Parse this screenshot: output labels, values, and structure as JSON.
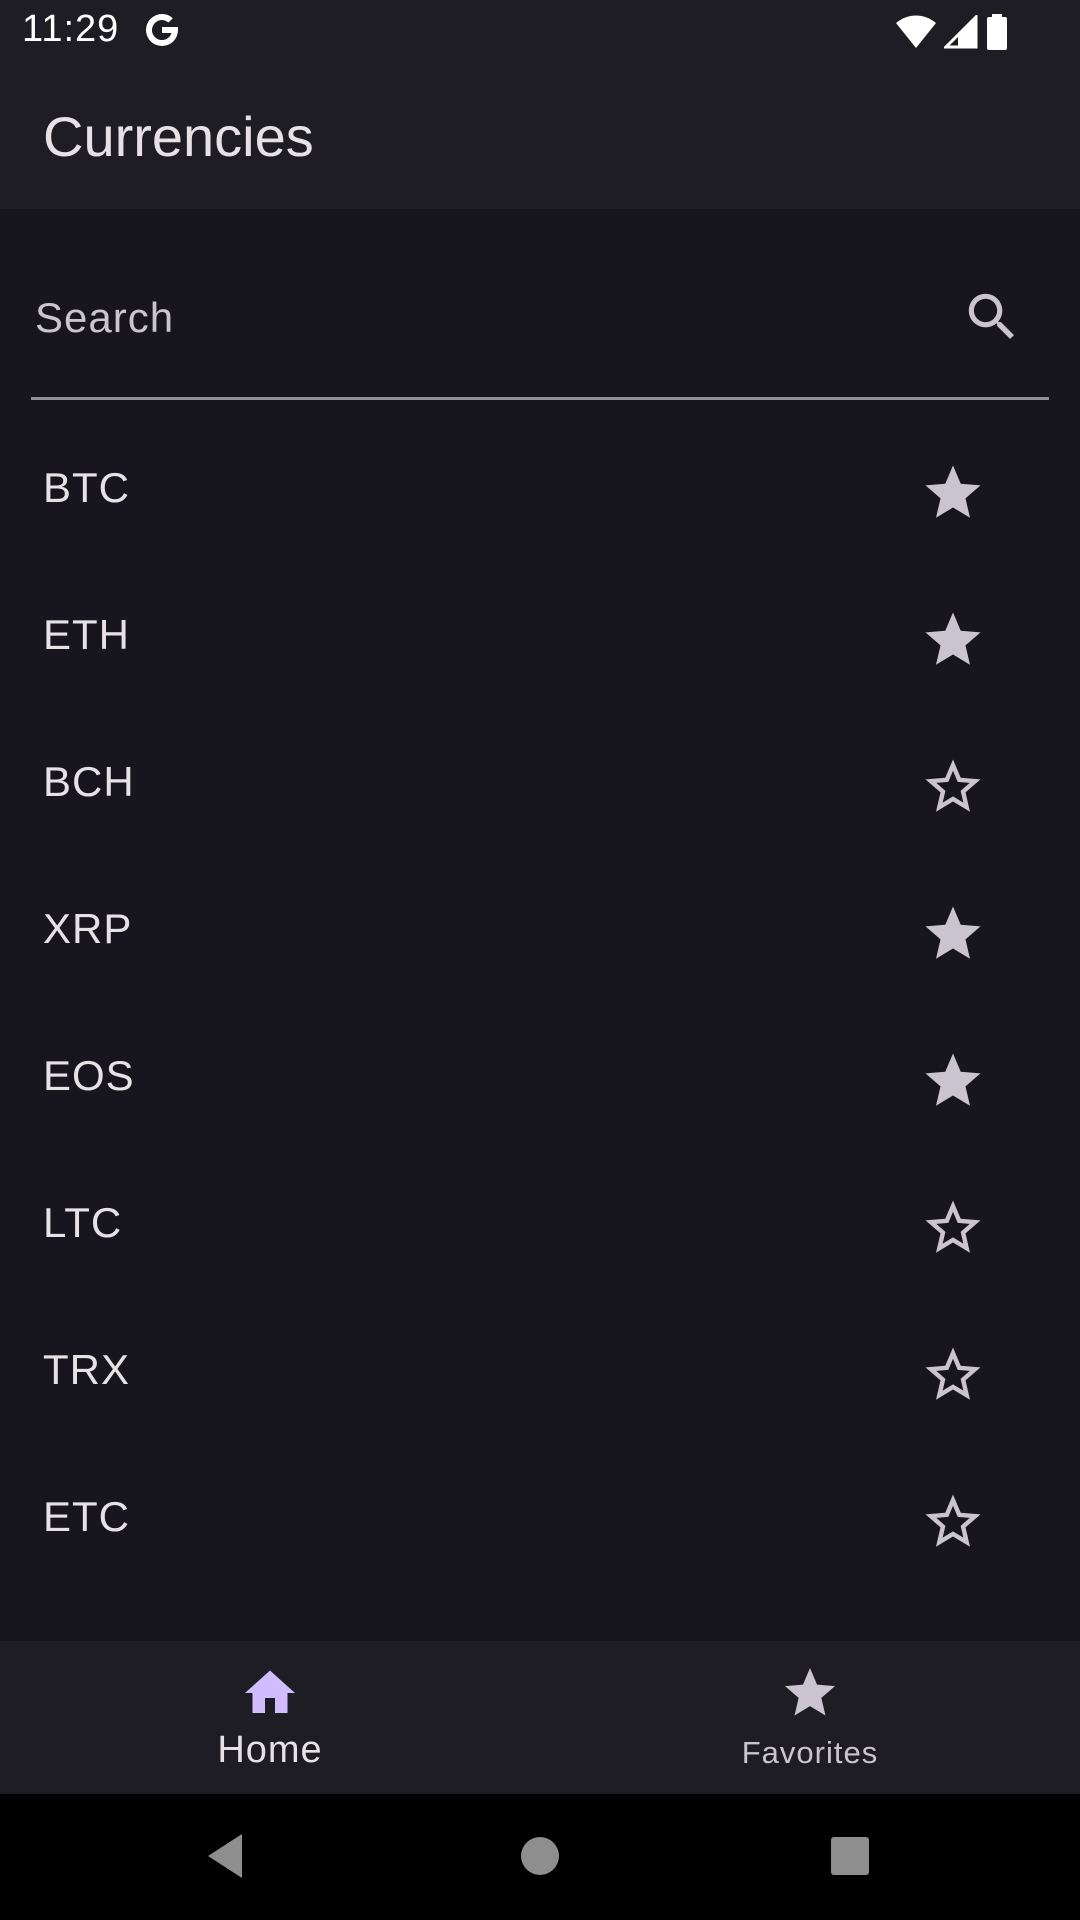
{
  "status_bar": {
    "time": "11:29",
    "google_icon": "google-g-icon",
    "wifi_icon": "wifi-icon",
    "signal_icon": "cell-signal-icon",
    "battery_icon": "battery-icon"
  },
  "app_bar": {
    "title": "Currencies"
  },
  "search": {
    "placeholder": "Search",
    "value": "",
    "icon": "search-icon"
  },
  "currencies": [
    {
      "symbol": "BTC",
      "favorite": true
    },
    {
      "symbol": "ETH",
      "favorite": true
    },
    {
      "symbol": "BCH",
      "favorite": false
    },
    {
      "symbol": "XRP",
      "favorite": true
    },
    {
      "symbol": "EOS",
      "favorite": true
    },
    {
      "symbol": "LTC",
      "favorite": false
    },
    {
      "symbol": "TRX",
      "favorite": false
    },
    {
      "symbol": "ETC",
      "favorite": false
    }
  ],
  "bottom_nav": {
    "home_label": "Home",
    "favorites_label": "Favorites",
    "selected": "home"
  },
  "system_nav": {
    "back_icon": "back-triangle-icon",
    "home_icon": "home-circle-icon",
    "recents_icon": "recents-square-icon"
  },
  "colors": {
    "background": "#17161f",
    "bar_surface": "#1e1d23",
    "on_surface": "#e6e1e5",
    "icon_tint": "#cac4d0",
    "home_icon_tint": "#d0bcff",
    "underline": "#938f99"
  }
}
